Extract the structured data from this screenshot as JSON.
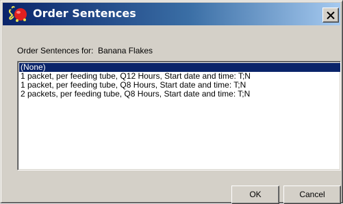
{
  "window": {
    "title": "Order Sentences"
  },
  "header": {
    "label": "Order Sentences for:",
    "value": "Banana Flakes"
  },
  "list": {
    "items": [
      {
        "label": "(None)",
        "selected": true
      },
      {
        "label": "1 packet, per feeding tube, Q12 Hours, Start date and time: T;N",
        "selected": false
      },
      {
        "label": "1 packet, per feeding tube, Q8 Hours, Start date and time: T;N",
        "selected": false
      },
      {
        "label": "2 packets, per feeding tube, Q8 Hours, Start date and time: T;N",
        "selected": false
      }
    ]
  },
  "buttons": {
    "ok": "OK",
    "cancel": "Cancel"
  },
  "icons": {
    "app": "app-icon",
    "close": "close-icon"
  },
  "colors": {
    "titlebar_start": "#0a246a",
    "titlebar_end": "#a6caf0",
    "selection": "#0a246a",
    "dialog_face": "#d4d0c8"
  }
}
